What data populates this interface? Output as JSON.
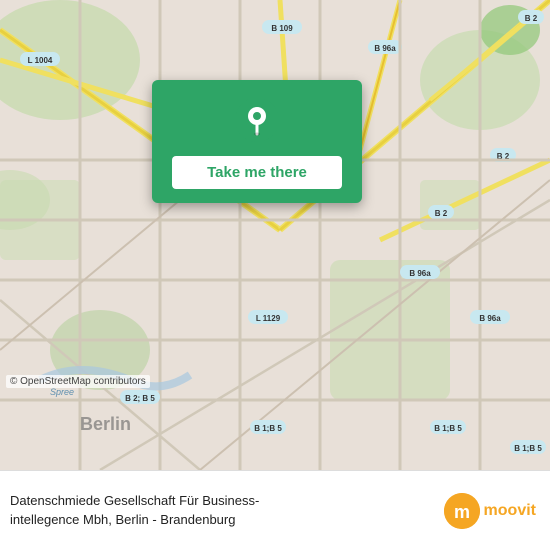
{
  "map": {
    "background_color": "#e8e0d8",
    "attribution": "© OpenStreetMap contributors"
  },
  "location_card": {
    "button_label": "Take me there",
    "background_color": "#2ea566"
  },
  "bottom_bar": {
    "company_name": "Datenschmiede Gesellschaft Für Business-\nintellegence Mbh, Berlin - Brandenburg",
    "logo_text": "moovit",
    "logo_icon": "m"
  }
}
